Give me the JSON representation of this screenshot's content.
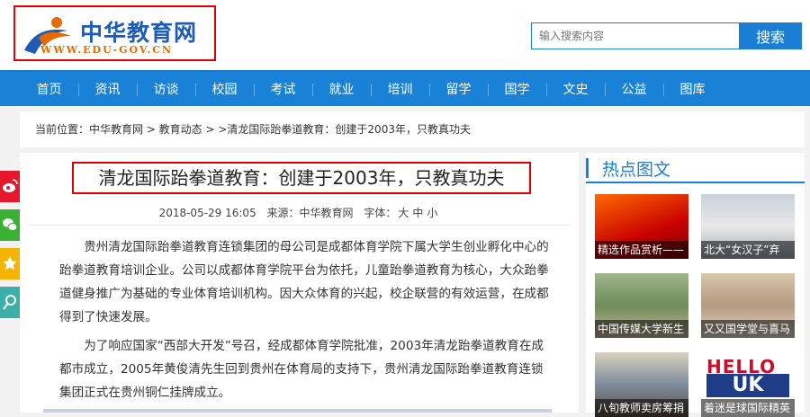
{
  "header": {
    "logo_text": "中华教育网",
    "logo_url": "WWW.EDU-GOV.CN",
    "search_placeholder": "输入搜索内容",
    "search_button": "搜索"
  },
  "nav": {
    "items": [
      "首页",
      "资讯",
      "访谈",
      "校园",
      "考试",
      "就业",
      "培训",
      "留学",
      "国学",
      "文史",
      "公益",
      "图库"
    ]
  },
  "breadcrumb": {
    "text": "当前位置：中华教育网 > 教育动态 > >清龙国际跆拳道教育：创建于2003年，只教真功夫"
  },
  "article": {
    "title": "清龙国际跆拳道教育：创建于2003年，只教真功夫",
    "date": "2018-05-29 16:05",
    "source": "来源：中华教育网",
    "font_label": "字体：",
    "font_large": "大",
    "font_medium": "中",
    "font_small": "小",
    "paragraphs": [
      "贵州清龙国际跆拳道教育连锁集团的母公司是成都体育学院下属大学生创业孵化中心的跆拳道教育培训企业。公司以成都体育学院平台为依托，儿童跆拳道教育为核心，大众跆拳道健身推广为基础的专业体育培训机构。因大众体育的兴起，校企联营的有效运营，在成都得到了快速发展。",
      "为了响应国家“西部大开发”号召，经成都体育学院批准，2003年清龙跆拳道教育在成都市成立，2005年黄俊清先生回到贵州在体育局的支持下，贵州清龙国际跆拳道教育连锁集团正式在贵州铜仁挂牌成立。"
    ]
  },
  "sidebar": {
    "title": "热点图文",
    "items": [
      {
        "caption": "精选作品赏析——"
      },
      {
        "caption": "北大“女汉子”弃"
      },
      {
        "caption": "中国传媒大学新生"
      },
      {
        "caption": "又又国学堂与喜马"
      },
      {
        "caption": "八旬教师卖房筹捐"
      },
      {
        "caption": "着迷是球国际精英"
      }
    ],
    "thumb6_hello": "HELLO",
    "thumb6_uk": "UK"
  },
  "share_icons": [
    "weibo-icon",
    "wechat-icon",
    "qzone-icon",
    "tencent-weibo-icon"
  ],
  "colors": {
    "brand_blue": "#1a82d6",
    "highlight_red": "#e00000",
    "logo_orange": "#e56a00"
  }
}
